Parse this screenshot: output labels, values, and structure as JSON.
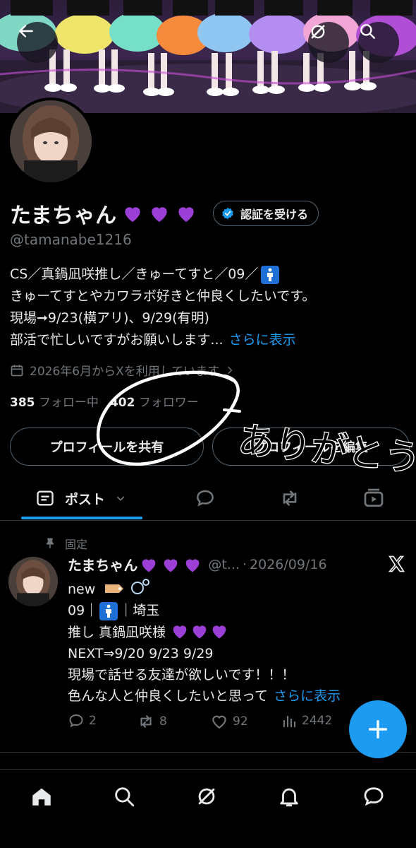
{
  "header": {
    "back_icon": "arrow-left-icon",
    "grok_icon": "grok-icon",
    "search_icon": "search-icon"
  },
  "profile": {
    "display_name": "たまちゃん",
    "name_emoji": [
      "💜",
      "💜",
      "💜"
    ],
    "verify_label": "認証を受ける",
    "handle": "@tamanabe1216",
    "bio": {
      "line1": "CS／真鍋凪咲推し／きゅーてすと／09／",
      "line2": "きゅーてすとやカワラボ好きと仲良くしたいです。",
      "line3": "現場➞9/23(横アリ)、9/29(有明)",
      "line4": "部活で忙しいですがお願いします...",
      "more": "さらに表示"
    },
    "joined": "2026年6月からXを利用しています",
    "following_count": "385",
    "following_label": "フォロー中",
    "followers_count": "402",
    "followers_label": "フォロワー",
    "share_label": "プロフィールを共有",
    "edit_label": "プロフィールを編集"
  },
  "tabs": {
    "posts_label": "ポスト"
  },
  "post": {
    "pinned_label": "固定",
    "author": "たまちゃん",
    "author_emoji": [
      "💜",
      "💜",
      "💜"
    ],
    "handle_short": "@t...",
    "date": "2026/09/16",
    "lines": {
      "l1": "new",
      "l2a": "09｜",
      "l2b": "｜埼玉",
      "l3": "推し 真鍋凪咲様",
      "l4": "NEXT⇒9/20  9/23  9/29",
      "l5": "現場で話せる友達が欲しいです！！！",
      "l6": "色んな人と仲良くしたいと思って",
      "more": "さらに表示"
    },
    "replies": "2",
    "reposts": "8",
    "likes": "92",
    "views": "2442"
  },
  "annotation": {
    "handwritten": "ありがとう"
  },
  "colors": {
    "accent": "#1d9bf0",
    "heart": "#9b3fd6",
    "muted": "#71767b"
  }
}
